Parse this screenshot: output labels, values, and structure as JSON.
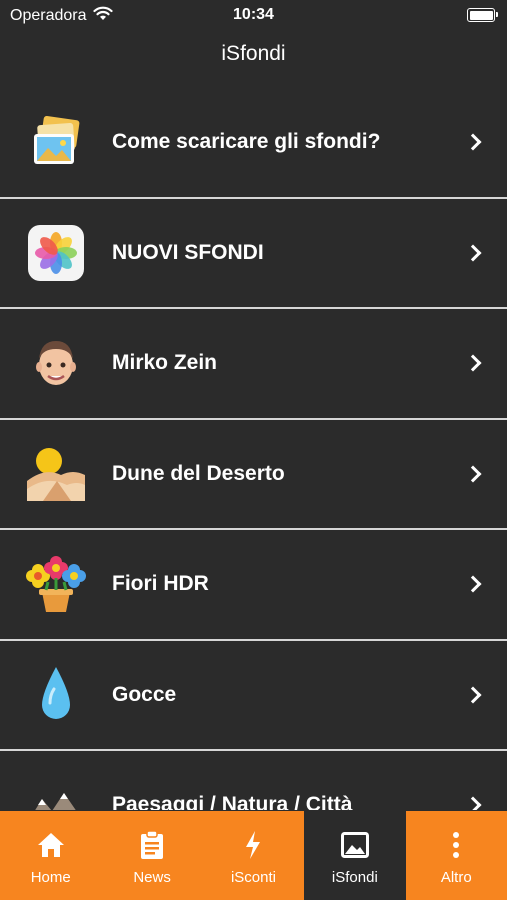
{
  "status_bar": {
    "carrier": "Operadora",
    "time": "10:34"
  },
  "nav": {
    "title": "iSfondi"
  },
  "list": {
    "items": [
      {
        "label": "Come scaricare gli sfondi?",
        "icon": "photos-stack-icon"
      },
      {
        "label": "NUOVI SFONDI",
        "icon": "photos-app-icon"
      },
      {
        "label": "Mirko Zein",
        "icon": "memoji-face-icon"
      },
      {
        "label": "Dune del Deserto",
        "icon": "desert-dunes-icon"
      },
      {
        "label": "Fiori HDR",
        "icon": "flower-pot-icon"
      },
      {
        "label": "Gocce",
        "icon": "water-drop-icon"
      },
      {
        "label": "Paesaggi / Natura / Città",
        "icon": "landscape-icon"
      }
    ]
  },
  "tabbar": {
    "tabs": [
      {
        "label": "Home",
        "icon": "home-icon",
        "active": false
      },
      {
        "label": "News",
        "icon": "clipboard-icon",
        "active": false
      },
      {
        "label": "iSconti",
        "icon": "lightning-icon",
        "active": false
      },
      {
        "label": "iSfondi",
        "icon": "image-icon",
        "active": true
      },
      {
        "label": "Altro",
        "icon": "more-vertical-icon",
        "active": false
      }
    ]
  },
  "colors": {
    "accent": "#f7851f",
    "background": "#2b2b2b",
    "separator": "#d6d6d6"
  }
}
